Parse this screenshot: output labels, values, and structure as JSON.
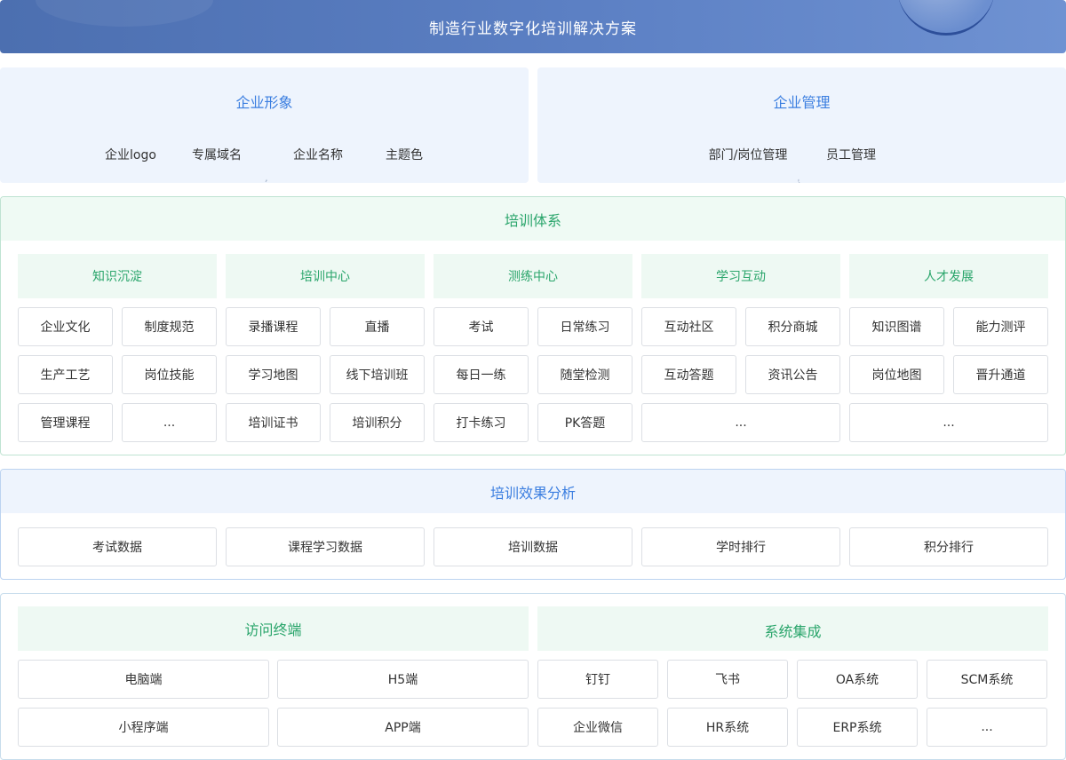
{
  "header": {
    "title": "制造行业数字化培训解决方案"
  },
  "brand": {
    "title": "企业形象",
    "items": [
      "企业logo",
      "专属域名",
      "企业名称",
      "主题色"
    ]
  },
  "management": {
    "title": "企业管理",
    "items": [
      "部门/岗位管理",
      "员工管理"
    ]
  },
  "training": {
    "title": "培训体系",
    "columns": [
      {
        "title": "知识沉淀",
        "items": [
          "企业文化",
          "制度规范",
          "生产工艺",
          "岗位技能",
          "管理课程",
          "..."
        ]
      },
      {
        "title": "培训中心",
        "items": [
          "录播课程",
          "直播",
          "学习地图",
          "线下培训班",
          "培训证书",
          "培训积分"
        ]
      },
      {
        "title": "测练中心",
        "items": [
          "考试",
          "日常练习",
          "每日一练",
          "随堂检测",
          "打卡练习",
          "PK答题"
        ]
      },
      {
        "title": "学习互动",
        "items": [
          "互动社区",
          "积分商城",
          "互动答题",
          "资讯公告",
          "..."
        ]
      },
      {
        "title": "人才发展",
        "items": [
          "知识图谱",
          "能力测评",
          "岗位地图",
          "晋升通道",
          "..."
        ]
      }
    ]
  },
  "analysis": {
    "title": "培训效果分析",
    "items": [
      "考试数据",
      "课程学习数据",
      "培训数据",
      "学时排行",
      "积分排行"
    ]
  },
  "access": {
    "title": "访问终端",
    "items": [
      "电脑端",
      "H5端",
      "小程序端",
      "APP端"
    ]
  },
  "integration": {
    "title": "系统集成",
    "items": [
      "钉钉",
      "飞书",
      "OA系统",
      "SCM系统",
      "企业微信",
      "HR系统",
      "ERP系统",
      "..."
    ]
  }
}
